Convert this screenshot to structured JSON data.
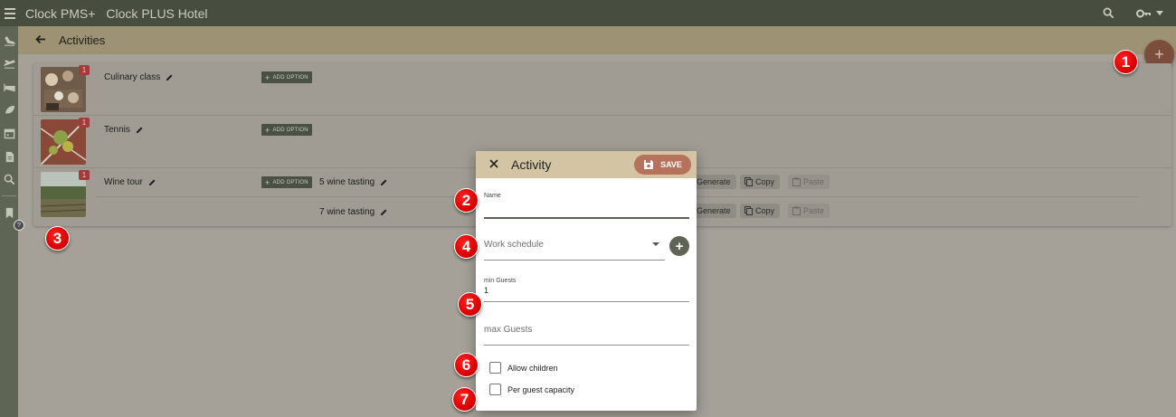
{
  "topbar": {
    "app_name": "Clock PMS+",
    "hotel_name": "Clock PLUS Hotel",
    "icons": [
      "hamburger-menu-icon",
      "search-icon",
      "key-icon",
      "caret-down-icon"
    ]
  },
  "rail": {
    "icons": [
      "plane-arrival-icon",
      "plane-departure-icon",
      "bed-icon",
      "leaf-icon",
      "calendar-icon",
      "document-icon",
      "search-icon",
      "bookmark-icon"
    ]
  },
  "subheader": {
    "title": "Activities"
  },
  "activities": [
    {
      "name": "Culinary class",
      "badge": "1",
      "add_option": "ADD OPTION",
      "options": []
    },
    {
      "name": "Tennis",
      "badge": "1",
      "add_option": "ADD OPTION",
      "options": []
    },
    {
      "name": "Wine tour",
      "badge": "1",
      "add_option": "ADD OPTION",
      "options": [
        {
          "name": "5 wine tasting",
          "generate": "Generate",
          "copy": "Copy",
          "paste": "Paste"
        },
        {
          "name": "7 wine tasting",
          "generate": "Generate",
          "copy": "Copy",
          "paste": "Paste"
        }
      ]
    }
  ],
  "dialog": {
    "title": "Activity",
    "save_label": "SAVE",
    "name_label": "Name",
    "name_value": "",
    "work_schedule_placeholder": "Work schedule",
    "min_guests_label": "min Guests",
    "min_guests_value": "1",
    "max_guests_placeholder": "max Guests",
    "allow_children_label": "Allow children",
    "allow_children_checked": false,
    "per_guest_capacity_label": "Per guest capacity",
    "per_guest_capacity_checked": false
  },
  "callouts": [
    "1",
    "2",
    "3",
    "4",
    "5",
    "6",
    "7"
  ],
  "colors": {
    "topbar": "#474e40",
    "rail": "#5e6554",
    "subheader": "#9e9274",
    "dialog_header": "#d3c5a3",
    "save_button": "#b7725c",
    "callout": "#dd0000"
  }
}
